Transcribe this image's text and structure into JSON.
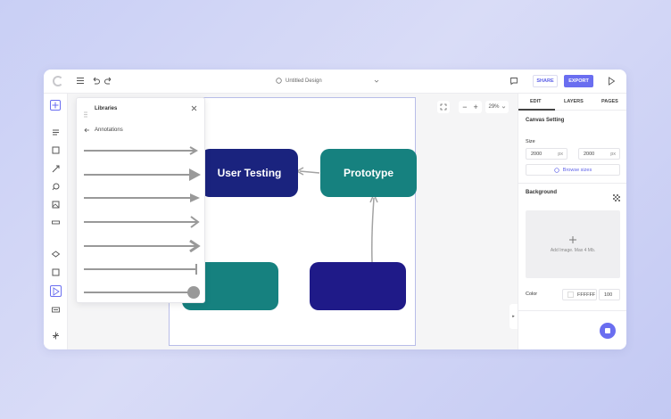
{
  "topbar": {
    "doc_title": "Untitled Design",
    "share_label": "SHARE",
    "export_label": "EXPORT"
  },
  "libraries": {
    "title": "Libraries",
    "back_label": "Annotations",
    "arrow_styles": [
      "line-arrow",
      "filled-arrow-large",
      "filled-arrow",
      "open-arrow",
      "open-arrow-bold",
      "bar-end",
      "circle-end"
    ]
  },
  "canvas": {
    "nodes": [
      {
        "label": "User Testing",
        "color": "#1a237e"
      },
      {
        "label": "Prototype",
        "color": "#16817f"
      },
      {
        "label": "",
        "color": "#16817f"
      },
      {
        "label": "",
        "color": "#1f1a88"
      }
    ]
  },
  "zoom": {
    "level": "29%"
  },
  "right_panel": {
    "tabs": [
      "EDIT",
      "LAYERS",
      "PAGES"
    ],
    "canvas_setting": "Canvas Setting",
    "size_label": "Size",
    "width": "2000",
    "height": "2000",
    "unit": "px",
    "browse_sizes": "Browse sizes",
    "background_label": "Background",
    "upload_text": "Add Image. Max 4 Mb.",
    "color_label": "Color",
    "color_value": "FFFFFF",
    "opacity_value": "100"
  },
  "colors": {
    "accent": "#6a6ef0",
    "navy": "#1a237e",
    "teal": "#16817f"
  }
}
